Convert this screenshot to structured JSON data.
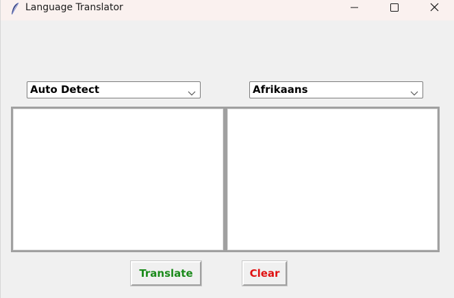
{
  "window": {
    "title": "Language Translator",
    "icon": "feather-icon"
  },
  "controls": {
    "minimize_icon": "minimize-icon",
    "maximize_icon": "maximize-icon",
    "close_icon": "close-icon"
  },
  "source_language": {
    "selected": "Auto Detect",
    "arrow_icon": "chevron-down-icon"
  },
  "target_language": {
    "selected": "Afrikaans",
    "arrow_icon": "chevron-down-icon"
  },
  "input_text": {
    "value": ""
  },
  "output_text": {
    "value": ""
  },
  "buttons": {
    "translate_label": "Translate",
    "translate_color": "#1a8a1a",
    "clear_label": "Clear",
    "clear_color": "#e01010"
  },
  "colors": {
    "titlebar_bg": "#faf1ef",
    "window_bg": "#f0f0f0"
  }
}
